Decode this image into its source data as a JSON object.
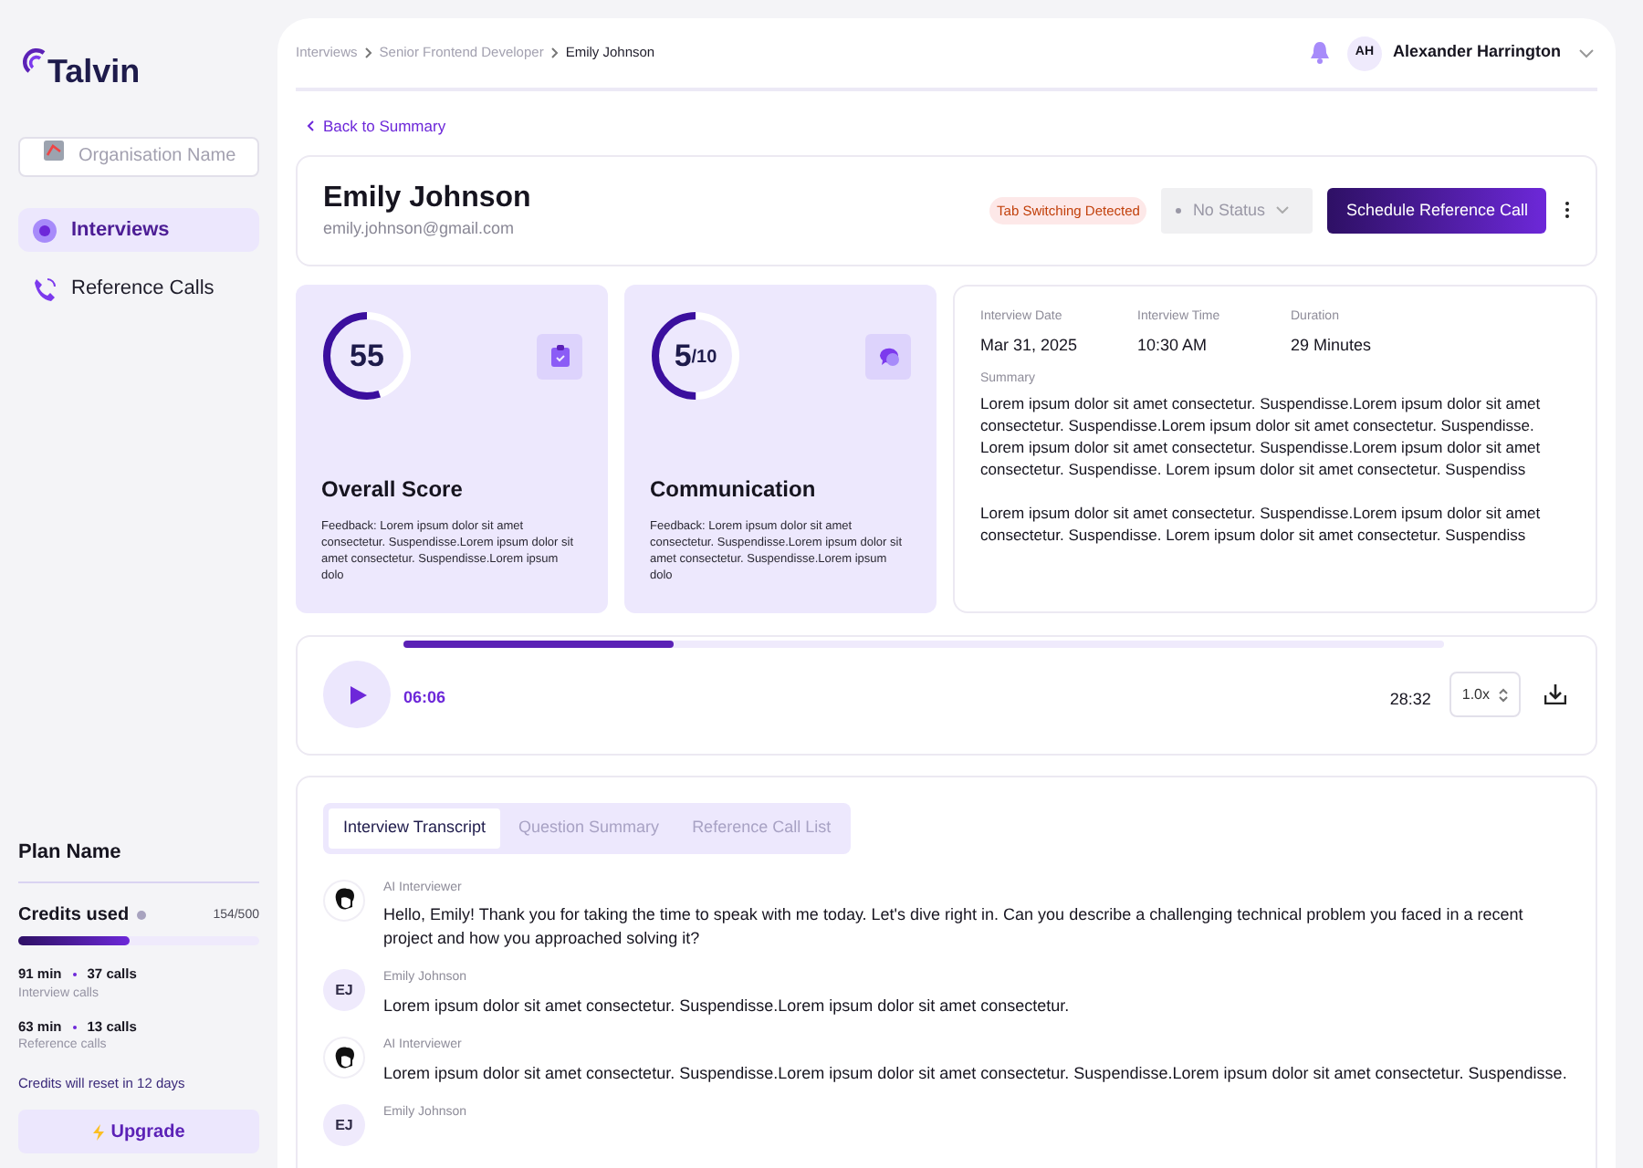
{
  "sidebar": {
    "logo": "Talvin",
    "organisation": {
      "placeholder": "Organisation Name"
    },
    "items": [
      {
        "label": "Interviews",
        "selected": true,
        "kind": "interviews"
      },
      {
        "label": "Reference Calls",
        "selected": false,
        "kind": "calls"
      }
    ],
    "plan": {
      "name": "Plan Name",
      "credits_label": "Credits used",
      "credits_value": "154/500",
      "level": 0.46,
      "stats": [
        {
          "minutes": "91 min",
          "calls": "37 calls",
          "label": "Interview calls"
        },
        {
          "minutes": "63 min",
          "calls": "13 calls",
          "label": "Reference calls"
        }
      ],
      "reset_note": "Credits will reset in 12 days",
      "upgrade": "Upgrade"
    }
  },
  "breadcrumb": [
    "Interviews",
    "Senior Frontend Developer",
    "Emily Johnson"
  ],
  "user": {
    "initials": "AH",
    "name": "Alexander Harrington"
  },
  "back_link": "Back to Summary",
  "candidate": {
    "name": "Emily Johnson",
    "email": "emily.johnson@gmail.com",
    "flag": "Tab Switching Detected",
    "status": "No Status",
    "action": "Schedule Reference Call"
  },
  "scores": [
    {
      "value": "55",
      "level": 0.55,
      "title": "Overall Score",
      "feedback": "Feedback: Lorem ipsum dolor sit amet consectetur. Suspendisse.Lorem ipsum dolor sit amet consectetur. Suspendisse.Lorem ipsum dolo",
      "kind": "clipboard"
    },
    {
      "value": "5",
      "suffix": "/10",
      "level": 0.5,
      "title": "Communication",
      "feedback": "Feedback: Lorem ipsum dolor sit amet consectetur. Suspendisse.Lorem ipsum dolor sit amet consectetur. Suspendisse.Lorem ipsum dolo",
      "kind": "chat"
    }
  ],
  "details": [
    {
      "label": "Interview Date",
      "value": "Mar 31, 2025"
    },
    {
      "label": "Interview Time",
      "value": "10:30 AM"
    },
    {
      "label": "Duration",
      "value": "29 Minutes"
    }
  ],
  "summary": {
    "label": "Summary",
    "paragraphs": [
      "Lorem ipsum dolor sit amet consectetur. Suspendisse.Lorem ipsum dolor sit amet consectetur. Suspendisse.Lorem ipsum dolor sit amet consectetur. Suspendisse. Lorem ipsum dolor sit amet consectetur. Suspendisse.Lorem ipsum dolor sit amet consectetur. Suspendisse. Lorem ipsum dolor sit amet consectetur. Suspendiss",
      "Lorem ipsum dolor sit amet consectetur. Suspendisse.Lorem ipsum dolor sit amet consectetur. Suspendisse. Lorem ipsum dolor sit amet consectetur. Suspendiss"
    ]
  },
  "player": {
    "level": 0.26,
    "current": "06:06",
    "total": "28:32",
    "speed": "1.0x"
  },
  "tabs": [
    {
      "label": "Interview Transcript",
      "selected": true
    },
    {
      "label": "Question Summary",
      "selected": false
    },
    {
      "label": "Reference Call List",
      "selected": false
    }
  ],
  "transcript": [
    {
      "kind": "ai",
      "speaker": "AI Interviewer",
      "text": "Hello, Emily! Thank you for taking the time to speak with me today. Let's dive right in. Can you describe a challenging technical problem you faced in a recent project and how you approached solving it?"
    },
    {
      "kind": "candidate",
      "initials": "EJ",
      "speaker": "Emily Johnson",
      "text": "Lorem ipsum dolor sit amet consectetur. Suspendisse.Lorem ipsum dolor sit amet consectetur."
    },
    {
      "kind": "ai",
      "speaker": "AI Interviewer",
      "text": "Lorem ipsum dolor sit amet consectetur. Suspendisse.Lorem ipsum dolor sit amet consectetur. Suspendisse.Lorem ipsum dolor sit amet consectetur. Suspendisse."
    },
    {
      "kind": "candidate",
      "initials": "EJ",
      "speaker": "Emily Johnson"
    }
  ]
}
